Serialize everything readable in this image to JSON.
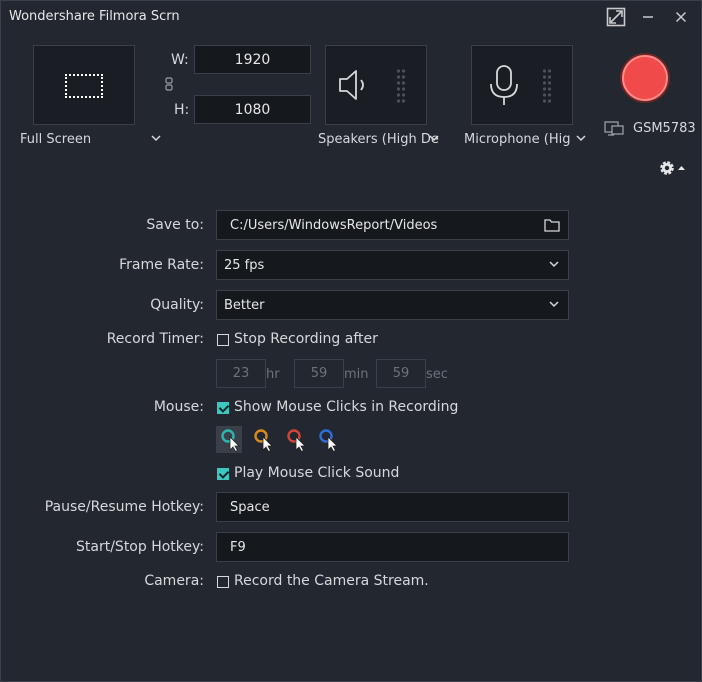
{
  "window": {
    "title": "Wondershare Filmora Scrn",
    "max_icon": "restore-icon",
    "min_icon": "minimize-icon",
    "close_icon": "close-icon"
  },
  "capture": {
    "mode_label": "Full Screen",
    "width_label": "W:",
    "height_label": "H:",
    "width": "1920",
    "height": "1080"
  },
  "audio": {
    "speakers_label": "Speakers (High De",
    "microphone_label": "Microphone (High I"
  },
  "record": {
    "button_color": "#f04a4a",
    "monitor_label": "GSM5783"
  },
  "form": {
    "save_to_label": "Save to:",
    "save_to_value": "C:/Users/WindowsReport/Videos",
    "frame_rate_label": "Frame Rate:",
    "frame_rate_value": "25 fps",
    "quality_label": "Quality:",
    "quality_value": "Better",
    "record_timer_label": "Record Timer:",
    "stop_recording_label": "Stop Recording after",
    "stop_recording_checked": false,
    "timer_hours": "23",
    "timer_hours_unit": "hr",
    "timer_minutes": "59",
    "timer_minutes_unit": "min",
    "timer_seconds": "59",
    "timer_seconds_unit": "sec",
    "mouse_label": "Mouse:",
    "show_clicks_label": "Show Mouse Clicks in Recording",
    "show_clicks_checked": true,
    "cursor_colors": [
      "#2bb7b0",
      "#d98a1a",
      "#d2443a",
      "#2d6fd6"
    ],
    "play_sound_label": "Play Mouse Click Sound",
    "play_sound_checked": true,
    "pause_hotkey_label": "Pause/Resume Hotkey:",
    "pause_hotkey_value": "Space",
    "startstop_hotkey_label": "Start/Stop Hotkey:",
    "startstop_hotkey_value": "F9",
    "camera_label": "Camera:",
    "camera_stream_label": "Record the Camera Stream.",
    "camera_checked": false
  },
  "accent_color": "#3cc7c0"
}
